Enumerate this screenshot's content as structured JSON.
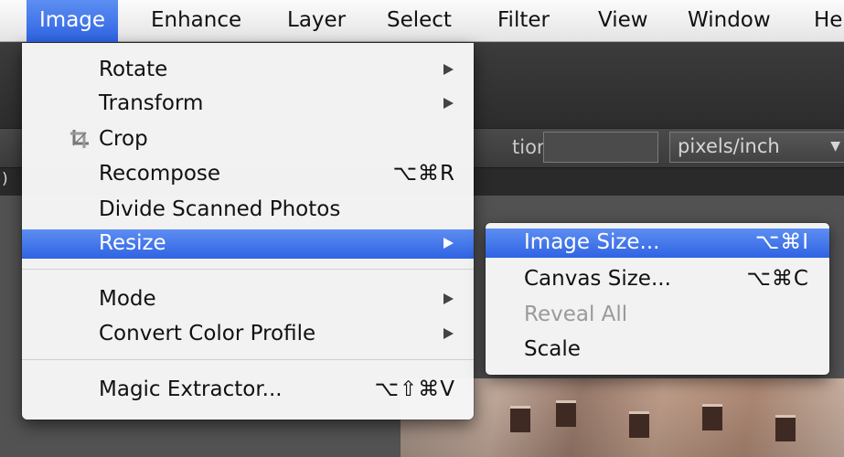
{
  "menubar": {
    "items": [
      {
        "label": "Image",
        "active": true
      },
      {
        "label": "Enhance"
      },
      {
        "label": "Layer"
      },
      {
        "label": "Select"
      },
      {
        "label": "Filter"
      },
      {
        "label": "View"
      },
      {
        "label": "Window"
      },
      {
        "label": "He"
      }
    ]
  },
  "options_bar": {
    "resolution_label": "tion:",
    "units_value": "pixels/inch"
  },
  "tab_edge_text": ")",
  "image_menu": {
    "items": [
      {
        "label": "Rotate",
        "submenu": true
      },
      {
        "label": "Transform",
        "submenu": true
      },
      {
        "label": "Crop",
        "icon": "crop-icon"
      },
      {
        "label": "Recompose",
        "shortcut": "⌥⌘R"
      },
      {
        "label": "Divide Scanned Photos"
      },
      {
        "label": "Resize",
        "submenu": true,
        "highlighted": true
      },
      {
        "label": "Mode",
        "submenu": true
      },
      {
        "label": "Convert Color Profile",
        "submenu": true
      },
      {
        "label": "Magic Extractor...",
        "shortcut": "⌥⇧⌘V"
      }
    ]
  },
  "resize_submenu": {
    "items": [
      {
        "label": "Image Size...",
        "shortcut": "⌥⌘I",
        "highlighted": true
      },
      {
        "label": "Canvas Size...",
        "shortcut": "⌥⌘C"
      },
      {
        "label": "Reveal All",
        "disabled": true
      },
      {
        "label": "Scale"
      }
    ]
  },
  "colors": {
    "highlight": "#3d74ea",
    "menu_bg": "#f6f6f6",
    "disabled_text": "#9a9a9a",
    "app_dark": "#3a3a3a"
  }
}
